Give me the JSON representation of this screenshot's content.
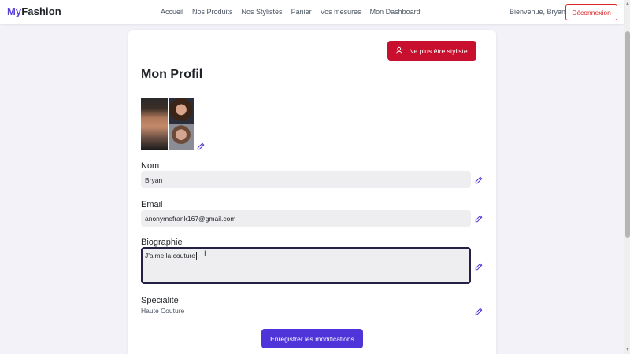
{
  "navbar": {
    "brand_part1": "My",
    "brand_part2": "Fashion",
    "links": [
      "Accueil",
      "Nos Produits",
      "Nos Stylistes",
      "Panier",
      "Vos mesures",
      "Mon Dashboard"
    ],
    "welcome": "Bienvenue, Bryan",
    "logout_label": "Déconnexion"
  },
  "profile": {
    "stop_stylist_label": "Ne plus être styliste",
    "title": "Mon Profil",
    "fields": {
      "nom": {
        "label": "Nom",
        "value": "Bryan"
      },
      "email": {
        "label": "Email",
        "value": "anonymefrank167@gmail.com"
      },
      "biographie": {
        "label": "Biographie",
        "value": "J'aime la couture"
      },
      "specialite": {
        "label": "Spécialité",
        "value": "Haute Couture"
      }
    },
    "save_label": "Enregistrer les modifications"
  },
  "colors": {
    "accent": "#4f35d9",
    "brand": "#5b3fd9",
    "danger": "#c8102e",
    "edit_icon": "#4f35d9"
  },
  "icons": {
    "edit": "pencil-icon",
    "stylist_btn": "user-minus-icon"
  }
}
